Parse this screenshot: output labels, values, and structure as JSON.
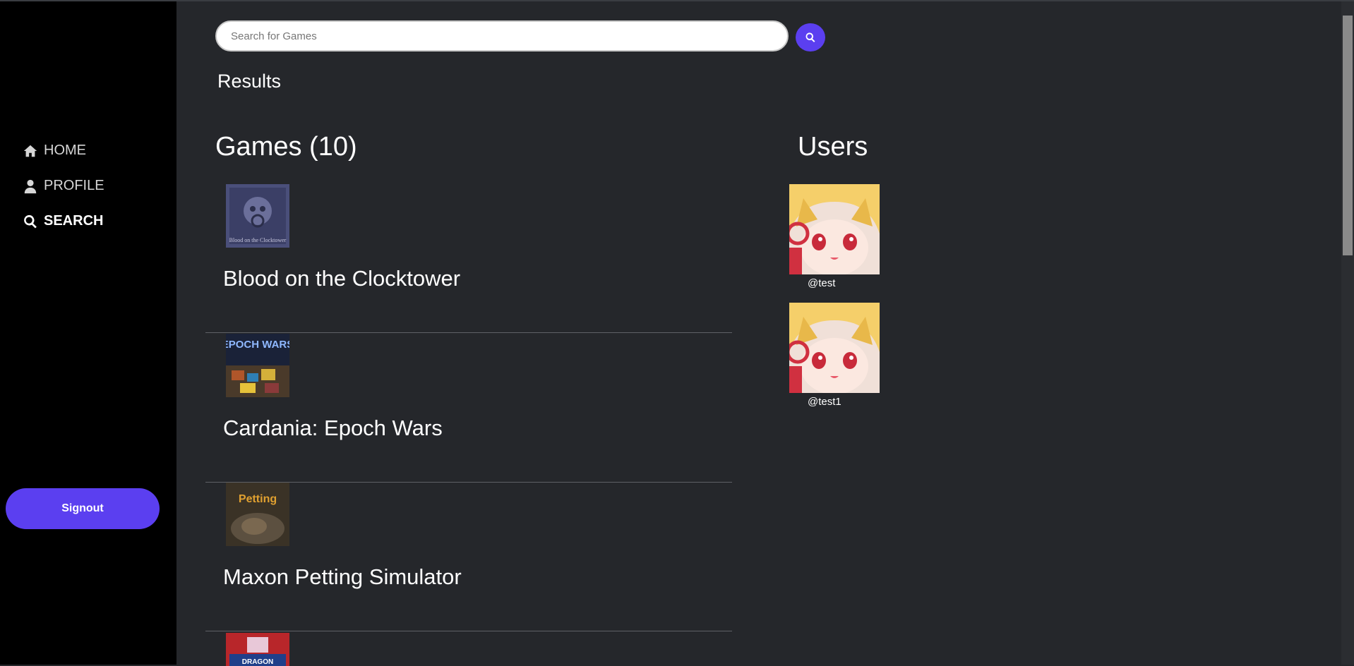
{
  "nav": {
    "items": [
      {
        "label": "HOME",
        "icon": "home-icon"
      },
      {
        "label": "PROFILE",
        "icon": "user-icon"
      },
      {
        "label": "SEARCH",
        "icon": "search-icon",
        "active": true
      }
    ],
    "signout_label": "Signout"
  },
  "search": {
    "placeholder": "Search for Games",
    "value": ""
  },
  "results": {
    "label": "Results",
    "games_heading": "Games (10)",
    "users_heading": "Users",
    "games": [
      {
        "title": "Blood on the Clocktower",
        "thumb_text": "Blood on the Clocktower"
      },
      {
        "title": "Cardania: Epoch Wars",
        "thumb_text": "EPOCH WARS"
      },
      {
        "title": "Maxon Petting Simulator",
        "thumb_text": "Petting"
      },
      {
        "title": "",
        "thumb_text": "DRAGON"
      }
    ],
    "users": [
      {
        "handle": "@test"
      },
      {
        "handle": "@test1"
      }
    ]
  },
  "colors": {
    "accent": "#5b3ff0",
    "sidebar_bg": "#000000",
    "main_bg": "#25272b"
  }
}
